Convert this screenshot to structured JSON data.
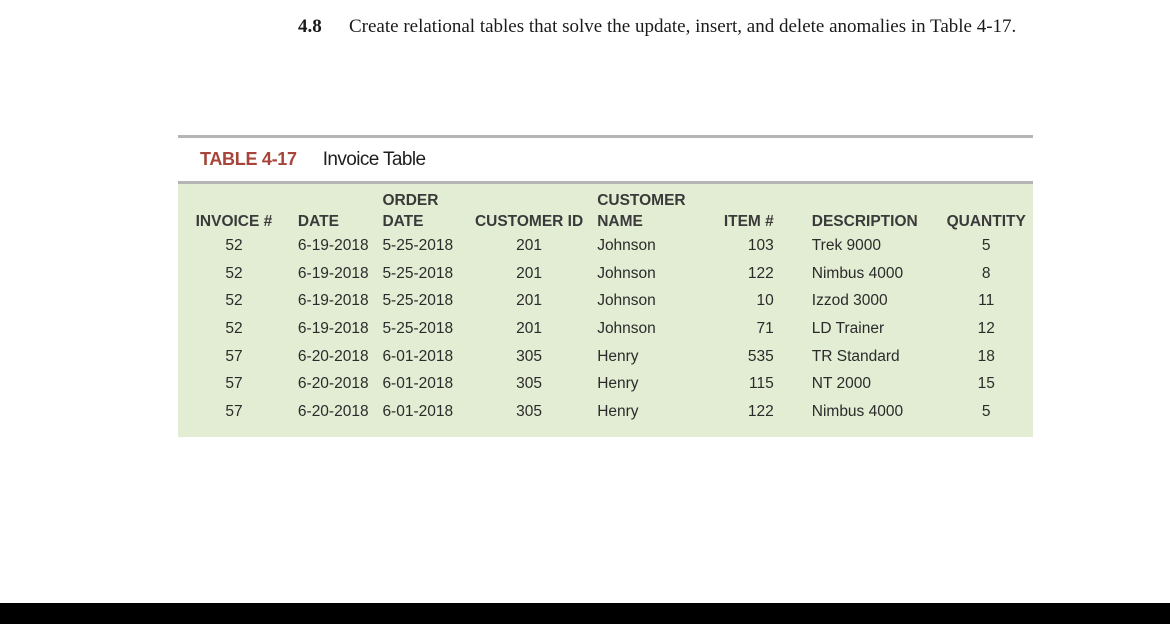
{
  "exercise": {
    "number": "4.8",
    "text": "Create relational tables that solve the update, insert, and delete anomalies in Table 4-17."
  },
  "table": {
    "label": "TABLE 4-17",
    "title": "Invoice Table",
    "columns": [
      {
        "line1": "",
        "line2": "INVOICE #"
      },
      {
        "line1": "",
        "line2": "DATE"
      },
      {
        "line1": "ORDER",
        "line2": "DATE"
      },
      {
        "line1": "",
        "line2": "CUSTOMER ID"
      },
      {
        "line1": "CUSTOMER",
        "line2": "NAME"
      },
      {
        "line1": "",
        "line2": "ITEM #"
      },
      {
        "line1": "",
        "line2": "DESCRIPTION"
      },
      {
        "line1": "",
        "line2": "QUANTITY"
      }
    ],
    "rows": [
      [
        "52",
        "6-19-2018",
        "5-25-2018",
        "201",
        "Johnson",
        "103",
        "Trek 9000",
        "5"
      ],
      [
        "52",
        "6-19-2018",
        "5-25-2018",
        "201",
        "Johnson",
        "122",
        "Nimbus 4000",
        "8"
      ],
      [
        "52",
        "6-19-2018",
        "5-25-2018",
        "201",
        "Johnson",
        "10",
        "Izzod 3000",
        "11"
      ],
      [
        "52",
        "6-19-2018",
        "5-25-2018",
        "201",
        "Johnson",
        "71",
        "LD Trainer",
        "12"
      ],
      [
        "57",
        "6-20-2018",
        "6-01-2018",
        "305",
        "Henry",
        "535",
        "TR Standard",
        "18"
      ],
      [
        "57",
        "6-20-2018",
        "6-01-2018",
        "305",
        "Henry",
        "115",
        "NT 2000",
        "15"
      ],
      [
        "57",
        "6-20-2018",
        "6-01-2018",
        "305",
        "Henry",
        "122",
        "Nimbus 4000",
        "5"
      ]
    ]
  },
  "colors": {
    "caption_label": "#a8453a",
    "table_background": "#e2edd3",
    "rule": "#b5b5b5"
  }
}
